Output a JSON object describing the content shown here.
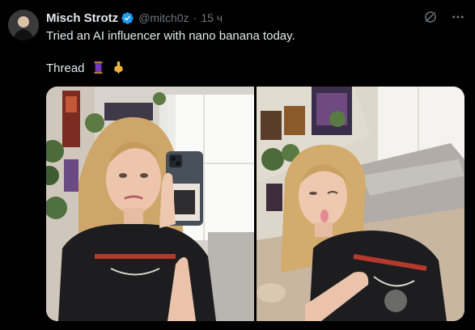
{
  "tweet": {
    "display_name": "Misch Strotz",
    "handle": "@mitch0z",
    "separator": "·",
    "time": "15 ч",
    "text_line1": "Tried an AI influencer with nano banana today.",
    "text_line2": "Thread",
    "emojis": [
      "thread-spool",
      "pointing-down"
    ]
  },
  "colors": {
    "background": "#000000",
    "text": "#e7e9ea",
    "secondary": "#71767b",
    "verified": "#1d9bf0"
  },
  "icons": [
    "verified-badge-icon",
    "grok-icon",
    "more-icon"
  ],
  "media": {
    "count": 2
  }
}
